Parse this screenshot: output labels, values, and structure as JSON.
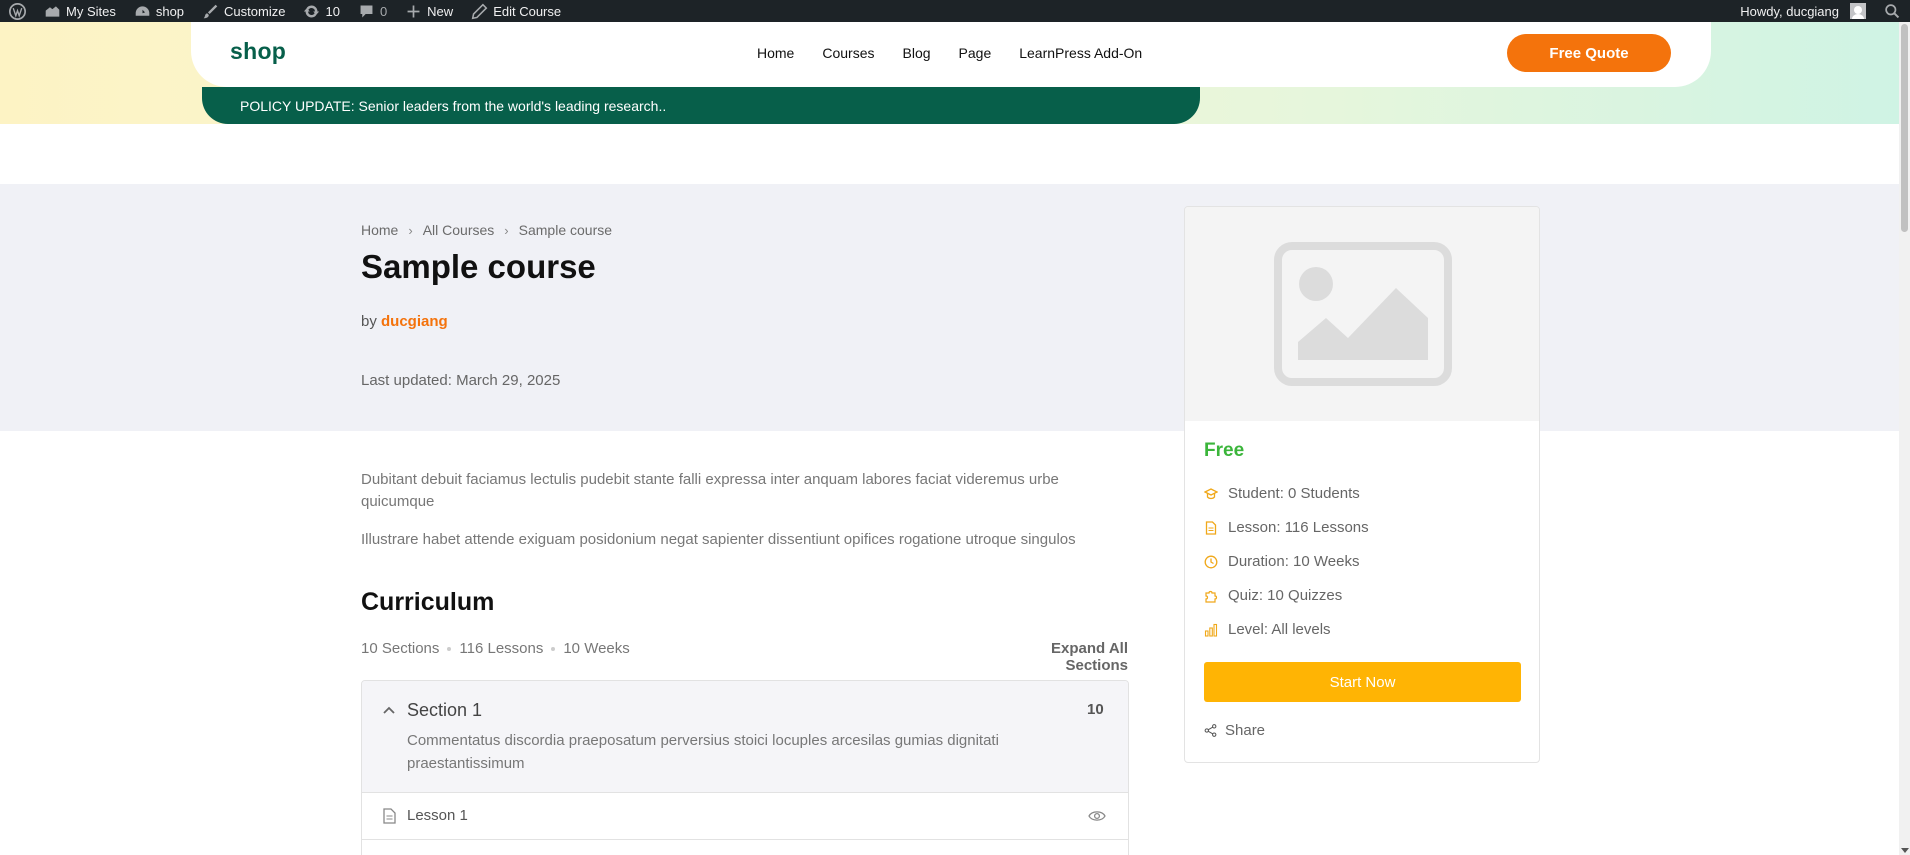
{
  "admin_bar": {
    "my_sites": "My Sites",
    "site": "shop",
    "customize": "Customize",
    "updates": "10",
    "comments": "0",
    "new": "New",
    "edit": "Edit Course",
    "howdy": "Howdy, ducgiang"
  },
  "header": {
    "logo": "shop",
    "nav": [
      "Home",
      "Courses",
      "Blog",
      "Page",
      "LearnPress Add-On"
    ],
    "cta": "Free Quote",
    "policy": "POLICY UPDATE: Senior leaders from the world's leading research.."
  },
  "course": {
    "breadcrumb": [
      "Home",
      "All Courses",
      "Sample course"
    ],
    "title": "Sample course",
    "by": "by",
    "author": "ducgiang",
    "updated": "Last updated: March 29, 2025",
    "description": [
      "Dubitant debuit faciamus lectulis pudebit stante falli expressa inter anquam labores faciat videremus urbe quicumque",
      "Illustrare habet attende exiguam posidonium negat sapienter dissentiunt opifices rogatione utroque singulos"
    ]
  },
  "curriculum": {
    "title": "Curriculum",
    "sections_count": "10 Sections",
    "lessons_count": "116 Lessons",
    "duration": "10 Weeks",
    "expand": "Expand All Sections",
    "section": {
      "name": "Section 1",
      "count": "10",
      "description": "Commentatus discordia praeposatum perversius stoici locuples arcesilas gumias dignitati praestantissimum"
    },
    "lesson": "Lesson 1"
  },
  "sidebar": {
    "price": "Free",
    "student": "Student: 0 Students",
    "lesson": "Lesson: 116 Lessons",
    "duration": "Duration: 10 Weeks",
    "quiz": "Quiz: 10 Quizzes",
    "level": "Level: All levels",
    "start": "Start Now",
    "share": "Share"
  },
  "colors": {
    "brand_green": "#075f4a",
    "cta_orange": "#f4730c",
    "start_yellow": "#ffb404",
    "price_green": "#3bb53b",
    "icon_amber": "#f0a81a"
  }
}
